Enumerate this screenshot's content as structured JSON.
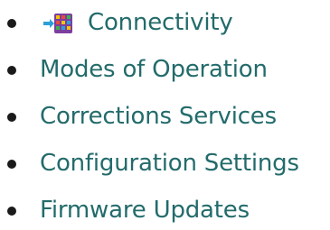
{
  "nav": {
    "items": [
      {
        "label": "Connectivity",
        "icon": "tile-grid-icon"
      },
      {
        "label": "Modes of Operation"
      },
      {
        "label": "Corrections Services"
      },
      {
        "label": "Configuration Settings"
      },
      {
        "label": "Firmware Updates"
      }
    ]
  },
  "colors": {
    "link": "#236b6b",
    "bullet": "#1a1a1a",
    "icon_arrow": "#2d9fd8",
    "icon_tile_bg": "#7b3f9e"
  }
}
